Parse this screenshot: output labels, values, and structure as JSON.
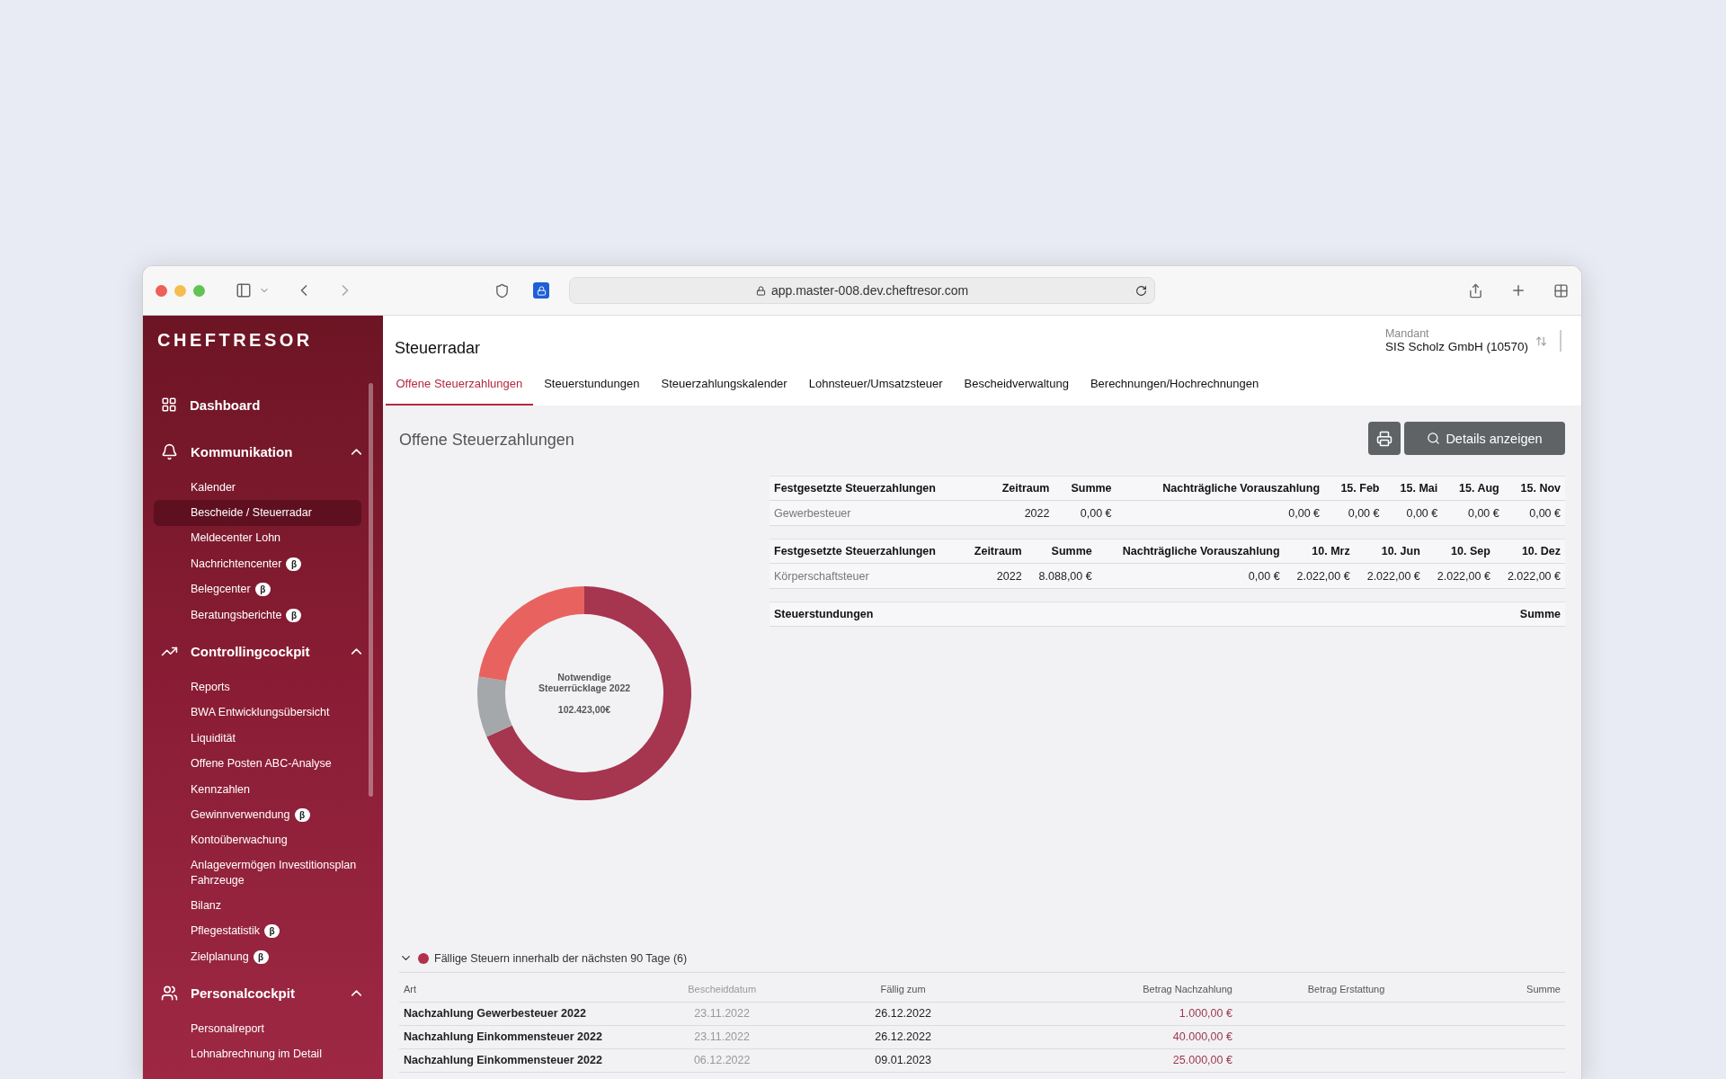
{
  "browser": {
    "url": "app.master-008.dev.cheftresor.com"
  },
  "sidebar": {
    "logo": "CHEFTRESOR",
    "items": [
      {
        "kind": "link",
        "label": "Dashboard"
      },
      {
        "kind": "section",
        "label": "Kommunikation",
        "expanded": true,
        "children": [
          {
            "label": "Kalender",
            "selected": false
          },
          {
            "label": "Bescheide / Steuerradar",
            "selected": true
          },
          {
            "label": "Meldecenter Lohn",
            "selected": false
          },
          {
            "label": "Nachrichtencenter",
            "badge": "β",
            "selected": false
          },
          {
            "label": "Belegcenter",
            "badge": "β",
            "selected": false
          },
          {
            "label": "Beratungsberichte",
            "badge": "β",
            "selected": false
          }
        ]
      },
      {
        "kind": "section",
        "label": "Controllingcockpit",
        "expanded": true,
        "children": [
          {
            "label": "Reports",
            "selected": false
          },
          {
            "label": "BWA  Entwicklungsübersicht",
            "selected": false
          },
          {
            "label": "Liquidität",
            "selected": false
          },
          {
            "label": "Offene Posten ABC-Analyse",
            "selected": false
          },
          {
            "label": "Kennzahlen",
            "selected": false
          },
          {
            "label": "Gewinnverwendung",
            "badge": "β",
            "selected": false
          },
          {
            "label": "Kontoüberwachung",
            "selected": false
          },
          {
            "label": "Anlagevermögen Investitionsplan Fahrzeuge",
            "selected": false
          },
          {
            "label": "Bilanz",
            "selected": false
          },
          {
            "label": "Pflegestatistik",
            "badge": "β",
            "selected": false
          },
          {
            "label": "Zielplanung",
            "badge": "β",
            "selected": false
          }
        ]
      },
      {
        "kind": "section",
        "label": "Personalcockpit",
        "expanded": true,
        "children": [
          {
            "label": "Personalreport",
            "selected": false
          },
          {
            "label": "Lohnabrechnung im Detail",
            "selected": false
          }
        ]
      }
    ]
  },
  "header": {
    "title": "Steuerradar",
    "client_label": "Mandant",
    "client": "SIS Scholz GmbH (10570)"
  },
  "tabs": [
    {
      "label": "Offene Steuerzahlungen",
      "selected": true
    },
    {
      "label": "Steuerstundungen",
      "selected": false
    },
    {
      "label": "Steuerzahlungskalender",
      "selected": false
    },
    {
      "label": "Lohnsteuer/Umsatzsteuer",
      "selected": false
    },
    {
      "label": "Bescheidverwaltung",
      "selected": false
    },
    {
      "label": "Berechnungen/Hochrechnungen",
      "selected": false
    }
  ],
  "section": {
    "title": "Offene Steuerzahlungen",
    "details_button": "Details anzeigen"
  },
  "donut": {
    "label": "Notwendige Steuerrücklage 2022",
    "value": "102.423,00€"
  },
  "tables": [
    {
      "columns": [
        "Festgesetzte Steuerzahlungen",
        "Zeitraum",
        "Summe",
        "Nachträgliche Vorauszahlung",
        "15. Feb",
        "15. Mai",
        "15. Aug",
        "15. Nov"
      ],
      "rows": [
        [
          "Gewerbesteuer",
          "2022",
          "0,00 €",
          "0,00 €",
          "0,00 €",
          "0,00 €",
          "0,00 €",
          "0,00 €"
        ]
      ]
    },
    {
      "columns": [
        "Festgesetzte Steuerzahlungen",
        "Zeitraum",
        "Summe",
        "Nachträgliche Vorauszahlung",
        "10. Mrz",
        "10. Jun",
        "10. Sep",
        "10. Dez"
      ],
      "rows": [
        [
          "Körperschaftsteuer",
          "2022",
          "8.088,00 €",
          "0,00 €",
          "2.022,00 €",
          "2.022,00 €",
          "2.022,00 €",
          "2.022,00 €"
        ]
      ]
    },
    {
      "columns": [
        "Steuerstundungen",
        "Summe"
      ]
    }
  ],
  "due": {
    "label": "Fällige Steuern innerhalb der nächsten 90 Tage (6)",
    "expanded": true,
    "color": "#b3304a",
    "columns": [
      "Art",
      "Bescheiddatum",
      "Fällig zum",
      "Betrag Nachzahlung",
      "Betrag Erstattung",
      "Summe"
    ],
    "rows": [
      [
        "Nachzahlung Gewerbesteuer 2022",
        "23.11.2022",
        "26.12.2022",
        "1.000,00 €",
        "",
        ""
      ],
      [
        "Nachzahlung Einkommensteuer 2022",
        "23.11.2022",
        "26.12.2022",
        "40.000,00 €",
        "",
        ""
      ],
      [
        "Nachzahlung Einkommensteuer 2022",
        "06.12.2022",
        "09.01.2023",
        "25.000,00 €",
        "",
        ""
      ]
    ]
  }
}
